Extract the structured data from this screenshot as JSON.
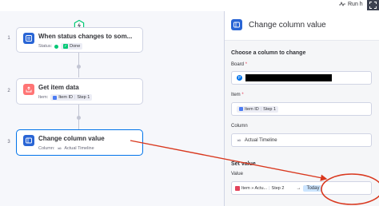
{
  "topbar": {
    "run_label": "Run h",
    "expand_icon": "expand-icon"
  },
  "canvas": {
    "trigger_icon": "lightning-icon",
    "steps": [
      {
        "number": "1",
        "title": "When status changes to som...",
        "sub_label": "Status:",
        "value": "Done",
        "icon": "list-icon"
      },
      {
        "number": "2",
        "title": "Get item data",
        "sub_label": "Item:",
        "value": "Item ID",
        "step": "Step 1",
        "icon": "export-icon"
      },
      {
        "number": "3",
        "title": "Change column value",
        "sub_label": "Column:",
        "value": "Actual Timeline",
        "icon": "column-icon"
      }
    ]
  },
  "panel": {
    "title": "Change column value",
    "choose_section": "Choose a column to change",
    "board_label": "Board",
    "item_label": "Item",
    "item_value": "Item ID",
    "item_step": "Step 1",
    "column_label": "Column",
    "column_value": "Actual Timeline",
    "set_value_section": "Set value",
    "value_label": "Value",
    "value_chip": "Item » Actu...",
    "value_step": "Step 2",
    "value_arrow": "→",
    "today_label": "Today",
    "required_mark": "*"
  },
  "annotation": {
    "arrow_color": "#d9381e",
    "circle_color": "#d9381e"
  }
}
